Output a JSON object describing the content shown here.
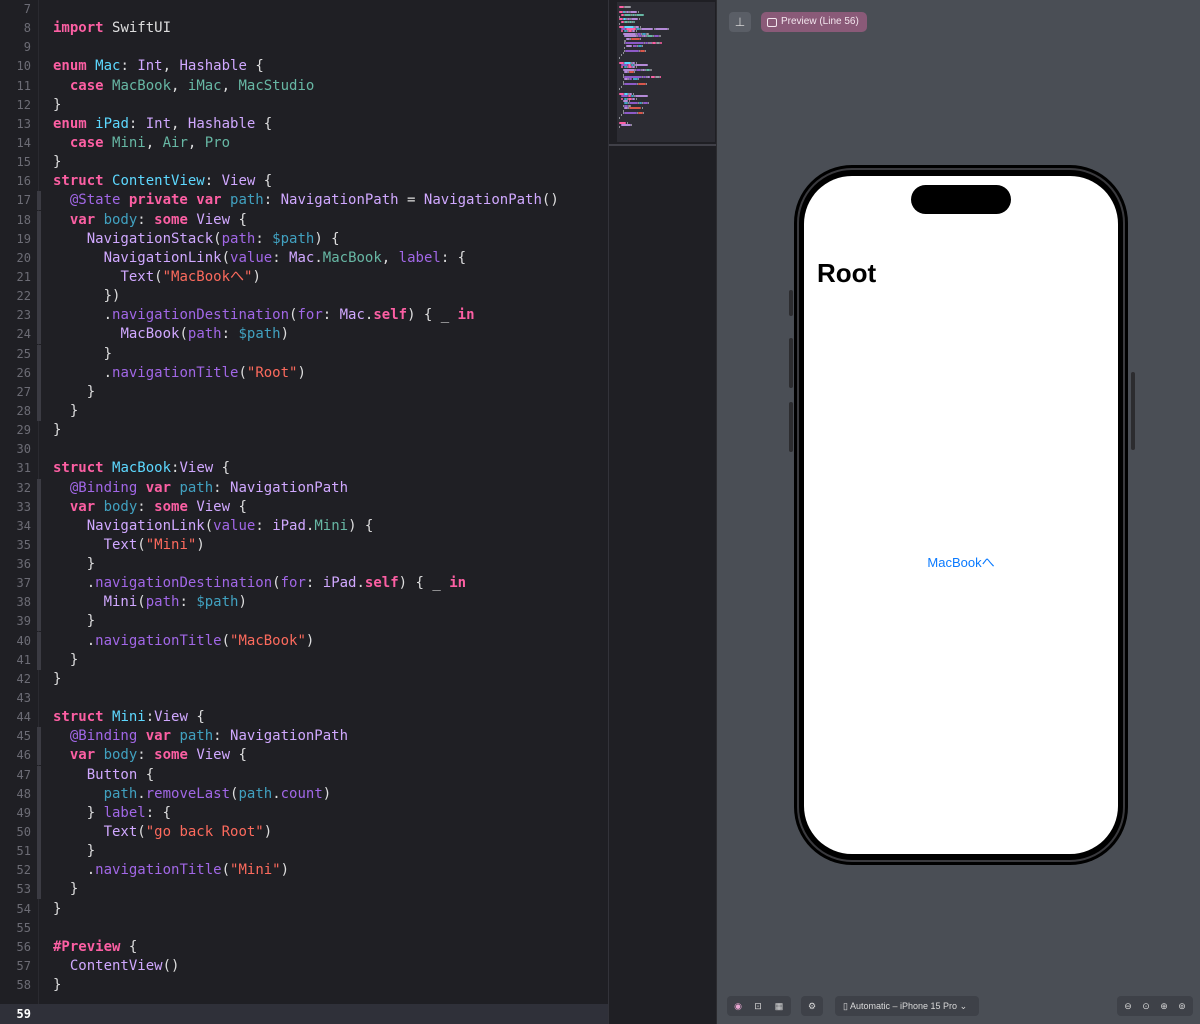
{
  "editor": {
    "lines": [
      {
        "n": "7",
        "t": []
      },
      {
        "n": "8",
        "t": [
          [
            "kw",
            "import "
          ],
          [
            "tx",
            "SwiftUI"
          ]
        ]
      },
      {
        "n": "9",
        "t": []
      },
      {
        "n": "10",
        "t": [
          [
            "kw",
            "enum "
          ],
          [
            "pt",
            "Mac"
          ],
          [
            "tx",
            ": "
          ],
          [
            "ty",
            "Int"
          ],
          [
            "tx",
            ", "
          ],
          [
            "ty",
            "Hashable"
          ],
          [
            "tx",
            " {"
          ]
        ]
      },
      {
        "n": "11",
        "t": [
          [
            "kw",
            "  case "
          ],
          [
            "fn",
            "MacBook"
          ],
          [
            "tx",
            ", "
          ],
          [
            "fn",
            "iMac"
          ],
          [
            "tx",
            ", "
          ],
          [
            "fn",
            "MacStudio"
          ]
        ]
      },
      {
        "n": "12",
        "t": [
          [
            "tx",
            "}"
          ]
        ]
      },
      {
        "n": "13",
        "t": [
          [
            "kw",
            "enum "
          ],
          [
            "pt",
            "iPad"
          ],
          [
            "tx",
            ": "
          ],
          [
            "ty",
            "Int"
          ],
          [
            "tx",
            ", "
          ],
          [
            "ty",
            "Hashable"
          ],
          [
            "tx",
            " {"
          ]
        ]
      },
      {
        "n": "14",
        "t": [
          [
            "kw",
            "  case "
          ],
          [
            "fn",
            "Mini"
          ],
          [
            "tx",
            ", "
          ],
          [
            "fn",
            "Air"
          ],
          [
            "tx",
            ", "
          ],
          [
            "fn",
            "Pro"
          ]
        ]
      },
      {
        "n": "15",
        "t": [
          [
            "tx",
            "}"
          ]
        ]
      },
      {
        "n": "16",
        "t": [
          [
            "kw",
            "struct "
          ],
          [
            "pt",
            "ContentView"
          ],
          [
            "tx",
            ": "
          ],
          [
            "ty",
            "View"
          ],
          [
            "tx",
            " {"
          ]
        ]
      },
      {
        "n": "17",
        "t": [
          [
            "at",
            "  @State "
          ],
          [
            "kw",
            "private var "
          ],
          [
            "vr",
            "path"
          ],
          [
            "tx",
            ": "
          ],
          [
            "ty",
            "NavigationPath"
          ],
          [
            "tx",
            " = "
          ],
          [
            "ty",
            "NavigationPath"
          ],
          [
            "tx",
            "()"
          ]
        ]
      },
      {
        "n": "18",
        "t": [
          [
            "kw",
            "  var "
          ],
          [
            "vr",
            "body"
          ],
          [
            "tx",
            ": "
          ],
          [
            "kw",
            "some "
          ],
          [
            "ty",
            "View"
          ],
          [
            "tx",
            " {"
          ]
        ]
      },
      {
        "n": "19",
        "t": [
          [
            "tx",
            "    "
          ],
          [
            "ty",
            "NavigationStack"
          ],
          [
            "tx",
            "("
          ],
          [
            "mt",
            "path"
          ],
          [
            "tx",
            ": "
          ],
          [
            "vr",
            "$path"
          ],
          [
            "tx",
            ") {"
          ]
        ]
      },
      {
        "n": "20",
        "t": [
          [
            "tx",
            "      "
          ],
          [
            "ty",
            "NavigationLink"
          ],
          [
            "tx",
            "("
          ],
          [
            "mt",
            "value"
          ],
          [
            "tx",
            ": "
          ],
          [
            "ty",
            "Mac"
          ],
          [
            "tx",
            "."
          ],
          [
            "fn",
            "MacBook"
          ],
          [
            "tx",
            ", "
          ],
          [
            "mt",
            "label"
          ],
          [
            "tx",
            ": {"
          ]
        ]
      },
      {
        "n": "21",
        "t": [
          [
            "tx",
            "        "
          ],
          [
            "ty",
            "Text"
          ],
          [
            "tx",
            "("
          ],
          [
            "st",
            "\"MacBookへ\""
          ],
          [
            "tx",
            ")"
          ]
        ]
      },
      {
        "n": "22",
        "t": [
          [
            "tx",
            "      })"
          ]
        ]
      },
      {
        "n": "23",
        "t": [
          [
            "tx",
            "      ."
          ],
          [
            "mt",
            "navigationDestination"
          ],
          [
            "tx",
            "("
          ],
          [
            "mt",
            "for"
          ],
          [
            "tx",
            ": "
          ],
          [
            "ty",
            "Mac"
          ],
          [
            "tx",
            "."
          ],
          [
            "kw",
            "self"
          ],
          [
            "tx",
            ") { _ "
          ],
          [
            "kw",
            "in"
          ]
        ]
      },
      {
        "n": "24",
        "t": [
          [
            "tx",
            "        "
          ],
          [
            "ty",
            "MacBook"
          ],
          [
            "tx",
            "("
          ],
          [
            "mt",
            "path"
          ],
          [
            "tx",
            ": "
          ],
          [
            "vr",
            "$path"
          ],
          [
            "tx",
            ")"
          ]
        ]
      },
      {
        "n": "25",
        "t": [
          [
            "tx",
            "      }"
          ]
        ]
      },
      {
        "n": "26",
        "t": [
          [
            "tx",
            "      ."
          ],
          [
            "mt",
            "navigationTitle"
          ],
          [
            "tx",
            "("
          ],
          [
            "st",
            "\"Root\""
          ],
          [
            "tx",
            ")"
          ]
        ]
      },
      {
        "n": "27",
        "t": [
          [
            "tx",
            "    }"
          ]
        ]
      },
      {
        "n": "28",
        "t": [
          [
            "tx",
            "  }"
          ]
        ]
      },
      {
        "n": "29",
        "t": [
          [
            "tx",
            "}"
          ]
        ]
      },
      {
        "n": "30",
        "t": []
      },
      {
        "n": "31",
        "t": [
          [
            "kw",
            "struct "
          ],
          [
            "pt",
            "MacBook"
          ],
          [
            "tx",
            ":"
          ],
          [
            "ty",
            "View"
          ],
          [
            "tx",
            " {"
          ]
        ]
      },
      {
        "n": "32",
        "t": [
          [
            "at",
            "  @Binding "
          ],
          [
            "kw",
            "var "
          ],
          [
            "vr",
            "path"
          ],
          [
            "tx",
            ": "
          ],
          [
            "ty",
            "NavigationPath"
          ]
        ]
      },
      {
        "n": "33",
        "t": [
          [
            "kw",
            "  var "
          ],
          [
            "vr",
            "body"
          ],
          [
            "tx",
            ": "
          ],
          [
            "kw",
            "some "
          ],
          [
            "ty",
            "View"
          ],
          [
            "tx",
            " {"
          ]
        ]
      },
      {
        "n": "34",
        "t": [
          [
            "tx",
            "    "
          ],
          [
            "ty",
            "NavigationLink"
          ],
          [
            "tx",
            "("
          ],
          [
            "mt",
            "value"
          ],
          [
            "tx",
            ": "
          ],
          [
            "ty",
            "iPad"
          ],
          [
            "tx",
            "."
          ],
          [
            "fn",
            "Mini"
          ],
          [
            "tx",
            ") {"
          ]
        ]
      },
      {
        "n": "35",
        "t": [
          [
            "tx",
            "      "
          ],
          [
            "ty",
            "Text"
          ],
          [
            "tx",
            "("
          ],
          [
            "st",
            "\"Mini\""
          ],
          [
            "tx",
            ")"
          ]
        ]
      },
      {
        "n": "36",
        "t": [
          [
            "tx",
            "    }"
          ]
        ]
      },
      {
        "n": "37",
        "t": [
          [
            "tx",
            "    ."
          ],
          [
            "mt",
            "navigationDestination"
          ],
          [
            "tx",
            "("
          ],
          [
            "mt",
            "for"
          ],
          [
            "tx",
            ": "
          ],
          [
            "ty",
            "iPad"
          ],
          [
            "tx",
            "."
          ],
          [
            "kw",
            "self"
          ],
          [
            "tx",
            ") { _ "
          ],
          [
            "kw",
            "in"
          ]
        ]
      },
      {
        "n": "38",
        "t": [
          [
            "tx",
            "      "
          ],
          [
            "ty",
            "Mini"
          ],
          [
            "tx",
            "("
          ],
          [
            "mt",
            "path"
          ],
          [
            "tx",
            ": "
          ],
          [
            "vr",
            "$path"
          ],
          [
            "tx",
            ")"
          ]
        ]
      },
      {
        "n": "39",
        "t": [
          [
            "tx",
            "    }"
          ]
        ]
      },
      {
        "n": "40",
        "t": [
          [
            "tx",
            "    ."
          ],
          [
            "mt",
            "navigationTitle"
          ],
          [
            "tx",
            "("
          ],
          [
            "st",
            "\"MacBook\""
          ],
          [
            "tx",
            ")"
          ]
        ]
      },
      {
        "n": "41",
        "t": [
          [
            "tx",
            "  }"
          ]
        ]
      },
      {
        "n": "42",
        "t": [
          [
            "tx",
            "}"
          ]
        ]
      },
      {
        "n": "43",
        "t": []
      },
      {
        "n": "44",
        "t": [
          [
            "kw",
            "struct "
          ],
          [
            "pt",
            "Mini"
          ],
          [
            "tx",
            ":"
          ],
          [
            "ty",
            "View"
          ],
          [
            "tx",
            " {"
          ]
        ]
      },
      {
        "n": "45",
        "t": [
          [
            "at",
            "  @Binding "
          ],
          [
            "kw",
            "var "
          ],
          [
            "vr",
            "path"
          ],
          [
            "tx",
            ": "
          ],
          [
            "ty",
            "NavigationPath"
          ]
        ]
      },
      {
        "n": "46",
        "t": [
          [
            "kw",
            "  var "
          ],
          [
            "vr",
            "body"
          ],
          [
            "tx",
            ": "
          ],
          [
            "kw",
            "some "
          ],
          [
            "ty",
            "View"
          ],
          [
            "tx",
            " {"
          ]
        ]
      },
      {
        "n": "47",
        "t": [
          [
            "tx",
            "    "
          ],
          [
            "ty",
            "Button"
          ],
          [
            "tx",
            " {"
          ]
        ]
      },
      {
        "n": "48",
        "t": [
          [
            "tx",
            "      "
          ],
          [
            "vr",
            "path"
          ],
          [
            "tx",
            "."
          ],
          [
            "mt",
            "removeLast"
          ],
          [
            "tx",
            "("
          ],
          [
            "vr",
            "path"
          ],
          [
            "tx",
            "."
          ],
          [
            "mt",
            "count"
          ],
          [
            "tx",
            ")"
          ]
        ]
      },
      {
        "n": "49",
        "t": [
          [
            "tx",
            "    } "
          ],
          [
            "mt",
            "label"
          ],
          [
            "tx",
            ": {"
          ]
        ]
      },
      {
        "n": "50",
        "t": [
          [
            "tx",
            "      "
          ],
          [
            "ty",
            "Text"
          ],
          [
            "tx",
            "("
          ],
          [
            "st",
            "\"go back Root\""
          ],
          [
            "tx",
            ")"
          ]
        ]
      },
      {
        "n": "51",
        "t": [
          [
            "tx",
            "    }"
          ]
        ]
      },
      {
        "n": "52",
        "t": [
          [
            "tx",
            "    ."
          ],
          [
            "mt",
            "navigationTitle"
          ],
          [
            "tx",
            "("
          ],
          [
            "st",
            "\"Mini\""
          ],
          [
            "tx",
            ")"
          ]
        ]
      },
      {
        "n": "53",
        "t": [
          [
            "tx",
            "  }"
          ]
        ]
      },
      {
        "n": "54",
        "t": [
          [
            "tx",
            "}"
          ]
        ]
      },
      {
        "n": "55",
        "t": []
      },
      {
        "n": "56",
        "t": [
          [
            "kw",
            "#Preview"
          ],
          [
            "tx",
            " {"
          ]
        ]
      },
      {
        "n": "57",
        "t": [
          [
            "tx",
            "  "
          ],
          [
            "ty",
            "ContentView"
          ],
          [
            "tx",
            "()"
          ]
        ]
      },
      {
        "n": "58",
        "t": [
          [
            "tx",
            "}"
          ]
        ]
      }
    ],
    "current_line": "59"
  },
  "preview": {
    "pin_icon": "pin-icon",
    "chip_label": "Preview (Line 56)",
    "nav_title": "Root",
    "link_text": "MacBookへ",
    "device_label": "Automatic – iPhone 15 Pro",
    "zoom_icons": [
      "zoom-out-icon",
      "zoom-fit-icon",
      "zoom-in-icon",
      "zoom-actual-icon"
    ]
  },
  "colors": {
    "editor_bg": "#1f1f24",
    "canvas_bg": "#4a4e55",
    "link": "#0a7aff"
  }
}
